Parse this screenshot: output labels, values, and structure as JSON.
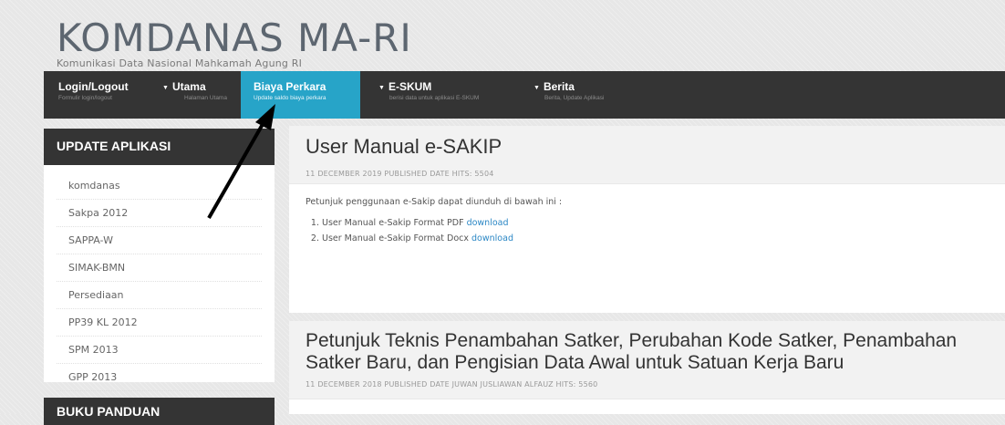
{
  "header": {
    "site_title": "KOMDANAS MA-RI",
    "site_subtitle": "Komunikasi Data Nasional Mahkamah Agung RI"
  },
  "nav": {
    "items": [
      {
        "label": "Login/Logout",
        "sub": "Formulir login/logout",
        "caret": false,
        "active": false
      },
      {
        "label": "Utama",
        "sub": "Halaman Utama",
        "caret": true,
        "active": false
      },
      {
        "label": "Biaya Perkara",
        "sub": "Update saldo biaya perkara",
        "caret": false,
        "active": true
      },
      {
        "label": "E-SKUM",
        "sub": "berisi data untuk aplikasi E-SKUM",
        "caret": true,
        "active": false
      },
      {
        "label": "Berita",
        "sub": "Berita, Update Aplikasi",
        "caret": true,
        "active": false
      }
    ],
    "active_color": "#27a4c8"
  },
  "sidebar": {
    "title": "UPDATE APLIKASI",
    "items": [
      "komdanas",
      "Sakpa 2012",
      "SAPPA-W",
      "SIMAK-BMN",
      "Persediaan",
      "PP39 KL 2012",
      "SPM 2013",
      "GPP 2013"
    ]
  },
  "sidebar2": {
    "title": "BUKU PANDUAN"
  },
  "articles": [
    {
      "title": "User Manual e-SAKIP",
      "meta": "11 DECEMBER 2019  PUBLISHED DATE  HITS: 5504",
      "intro": "Petunjuk penggunaan e-Sakip dapat diunduh di bawah ini :",
      "list": [
        {
          "text": "User Manual e-Sakip Format PDF ",
          "link": "download"
        },
        {
          "text": "User Manual e-Sakip Format Docx ",
          "link": "download"
        }
      ]
    },
    {
      "title_line1": "Petunjuk Teknis Penambahan Satker, Perubahan Kode Satker, Penambahan",
      "title_line2": "Satker Baru, dan Pengisian Data Awal untuk Satuan Kerja Baru",
      "meta": "11 DECEMBER 2018  PUBLISHED DATE  JUWAN JUSLIAWAN ALFAUZ  HITS: 5560"
    }
  ]
}
